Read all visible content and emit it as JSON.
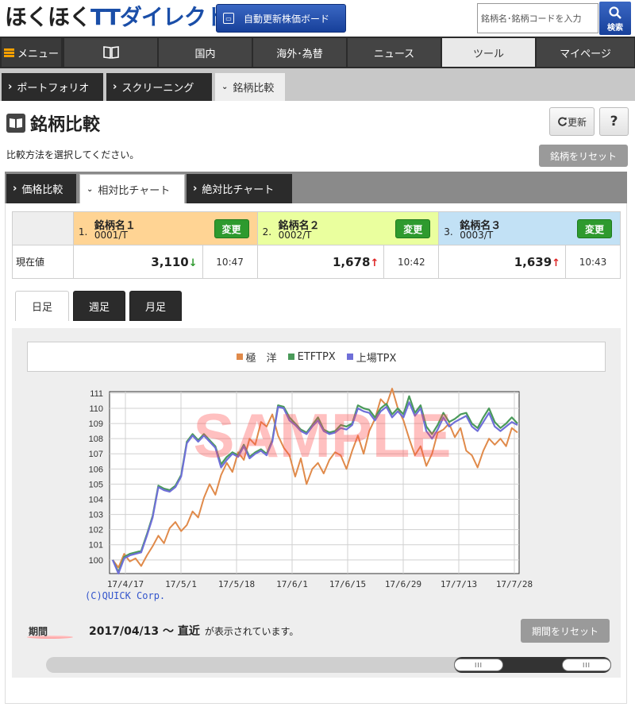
{
  "header": {
    "logo_part1": "ほくほく",
    "logo_part2": "TT",
    "logo_part3": "ダイレクト",
    "board_button": "自動更新株価ボード",
    "search_placeholder": "銘柄名･銘柄コードを入力",
    "search_button": "検索"
  },
  "nav": {
    "menu": "メニュー",
    "items": [
      "国内",
      "海外･為替",
      "ニュース",
      "ツール",
      "マイページ"
    ],
    "active": "ツール"
  },
  "subnav": {
    "items": [
      "ポートフォリオ",
      "スクリーニング",
      "銘柄比較"
    ]
  },
  "page": {
    "title": "銘柄比較",
    "refresh": "更新",
    "help": "?",
    "instruction": "比較方法を選択してください。",
    "reset_symbols": "銘柄をリセット"
  },
  "compare_tabs": [
    "価格比較",
    "相対比チャート",
    "絶対比チャート"
  ],
  "stocks": {
    "row_label": "現在値",
    "change_label": "変更",
    "items": [
      {
        "num": "1.",
        "name": "銘柄名１",
        "code": "0001/T",
        "price": "3,110",
        "dir": "down",
        "time": "10:47",
        "color": "#ffd494"
      },
      {
        "num": "2.",
        "name": "銘柄名２",
        "code": "0002/T",
        "price": "1,678",
        "dir": "up",
        "time": "10:42",
        "color": "#eaff9e"
      },
      {
        "num": "3.",
        "name": "銘柄名３",
        "code": "0003/T",
        "price": "1,639",
        "dir": "up",
        "time": "10:43",
        "color": "#c2e1f5"
      }
    ]
  },
  "period_tabs": [
    "日足",
    "週足",
    "月足"
  ],
  "period": {
    "label": "期間",
    "range": "2017/04/13 ～ 直近",
    "suffix": "が表示されています。",
    "reset": "期間をリセット"
  },
  "copyright": "(C)QUICK Corp.",
  "watermark": "SAMPLE",
  "chart_data": {
    "type": "line",
    "x_ticks": [
      "17/4/17",
      "17/5/1",
      "17/5/18",
      "17/6/1",
      "17/6/15",
      "17/6/29",
      "17/7/13",
      "17/7/28"
    ],
    "y_ticks": [
      100,
      101,
      102,
      103,
      104,
      105,
      106,
      107,
      108,
      109,
      110,
      111
    ],
    "ylim": [
      99.1,
      111.1
    ],
    "grid": true,
    "legend_position": "top",
    "series": [
      {
        "name": "極　洋",
        "color": "#e08a4a",
        "values": [
          100,
          99.5,
          100.4,
          99.9,
          100.1,
          99.6,
          100.3,
          100.9,
          101.6,
          101.1,
          102.1,
          102.5,
          101.9,
          102.3,
          103.2,
          102.8,
          104.1,
          105.0,
          104.3,
          105.6,
          106.4,
          105.8,
          107.1,
          106.6,
          108.0,
          107.6,
          109.1,
          108.8,
          109.6,
          108.2,
          107.4,
          106.9,
          105.5,
          106.7,
          105.0,
          106.0,
          106.4,
          105.7,
          106.6,
          107.1,
          106.9,
          106.0,
          107.2,
          108.2,
          107.0,
          108.5,
          109.3,
          110.6,
          110.2,
          111.3,
          110.0,
          109.2,
          108.0,
          106.9,
          107.5,
          106.2,
          107.0,
          108.4,
          108.6,
          109.0,
          108.1,
          108.7,
          107.2,
          106.9,
          106.1,
          107.2,
          108.0,
          107.6,
          108.0,
          107.5,
          108.7,
          108.4
        ]
      },
      {
        "name": "ETFTPX",
        "color": "#4a9a5a",
        "values": [
          100,
          99.2,
          100.2,
          100.4,
          100.5,
          100.6,
          101.7,
          102.9,
          104.9,
          104.7,
          104.6,
          104.9,
          105.6,
          107.8,
          108.3,
          107.9,
          108.3,
          107.9,
          107.5,
          106.3,
          106.8,
          107.1,
          106.9,
          107.6,
          106.8,
          107.1,
          107.3,
          107.0,
          107.9,
          110.2,
          110.1,
          109.4,
          109.0,
          108.6,
          108.4,
          108.9,
          109.4,
          108.6,
          108.4,
          108.5,
          108.9,
          108.8,
          109.0,
          110.2,
          110.0,
          109.9,
          109.4,
          110.0,
          110.3,
          109.6,
          110.0,
          109.6,
          110.8,
          109.7,
          110.2,
          108.8,
          108.3,
          108.9,
          109.7,
          109.1,
          109.3,
          109.6,
          109.7,
          109.0,
          108.7,
          109.4,
          110.0,
          109.1,
          108.7,
          109.0,
          109.4,
          109.0
        ]
      },
      {
        "name": "上場TPX",
        "color": "#6f6fd8",
        "values": [
          100,
          99.1,
          100.1,
          100.3,
          100.4,
          100.5,
          101.6,
          102.8,
          104.8,
          104.6,
          104.5,
          104.8,
          105.5,
          107.7,
          108.2,
          107.8,
          108.2,
          107.8,
          107.4,
          106.1,
          106.6,
          107.0,
          106.8,
          107.5,
          106.7,
          107.0,
          107.2,
          106.9,
          107.8,
          110.1,
          110.0,
          109.2,
          108.9,
          108.5,
          108.3,
          108.8,
          109.2,
          108.5,
          108.3,
          108.4,
          108.7,
          108.6,
          108.9,
          110.0,
          109.8,
          109.7,
          109.2,
          109.8,
          110.1,
          109.4,
          109.8,
          109.4,
          110.4,
          109.5,
          110.0,
          108.5,
          108.0,
          108.6,
          109.4,
          108.8,
          109.1,
          109.3,
          109.5,
          108.8,
          108.5,
          109.1,
          109.7,
          108.8,
          108.5,
          108.8,
          109.1,
          108.9
        ]
      }
    ]
  }
}
